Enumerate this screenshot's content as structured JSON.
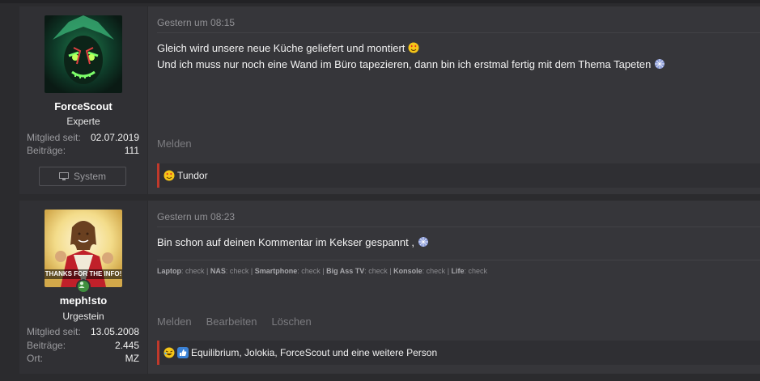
{
  "posts": [
    {
      "username": "ForceScout",
      "usertitle": "Experte",
      "stats": [
        {
          "label": "Mitglied seit:",
          "value": "02.07.2019"
        },
        {
          "label": "Beiträge:",
          "value": "111"
        }
      ],
      "system_button": "System",
      "date": "Gestern um 08:15",
      "message_lines": [
        "Gleich wird unsere neue Küche geliefert und montiert",
        "Und ich muss nur noch eine Wand im Büro tapezieren, dann bin ich erstmal fertig mit dem Thema Tapeten"
      ],
      "actions": [
        "Melden"
      ],
      "reactions": "Tundor"
    },
    {
      "username": "meph!sto",
      "usertitle": "Urgestein",
      "avatar_caption": "THANKS FOR THE INFO!",
      "stats": [
        {
          "label": "Mitglied seit:",
          "value": "13.05.2008"
        },
        {
          "label": "Beiträge:",
          "value": "2.445"
        },
        {
          "label": "Ort:",
          "value": "MZ"
        }
      ],
      "date": "Gestern um 08:23",
      "message_lines": [
        "Bin schon auf deinen Kommentar im Kekser gespannt ,"
      ],
      "signature": [
        {
          "label": "Laptop",
          "value": "check"
        },
        {
          "label": "NAS",
          "value": "check"
        },
        {
          "label": "Smartphone",
          "value": "check"
        },
        {
          "label": "Big Ass TV",
          "value": "check"
        },
        {
          "label": "Konsole",
          "value": "check"
        },
        {
          "label": "Life",
          "value": "check"
        }
      ],
      "actions": [
        "Melden",
        "Bearbeiten",
        "Löschen"
      ],
      "reactions": "Equilibrium, Jolokia, ForceScout und eine weitere Person"
    }
  ],
  "colors": {
    "accent": "#c0392b",
    "background": "#2b2b2e",
    "post_bg": "#36363a",
    "online": "#3f8f3f"
  }
}
